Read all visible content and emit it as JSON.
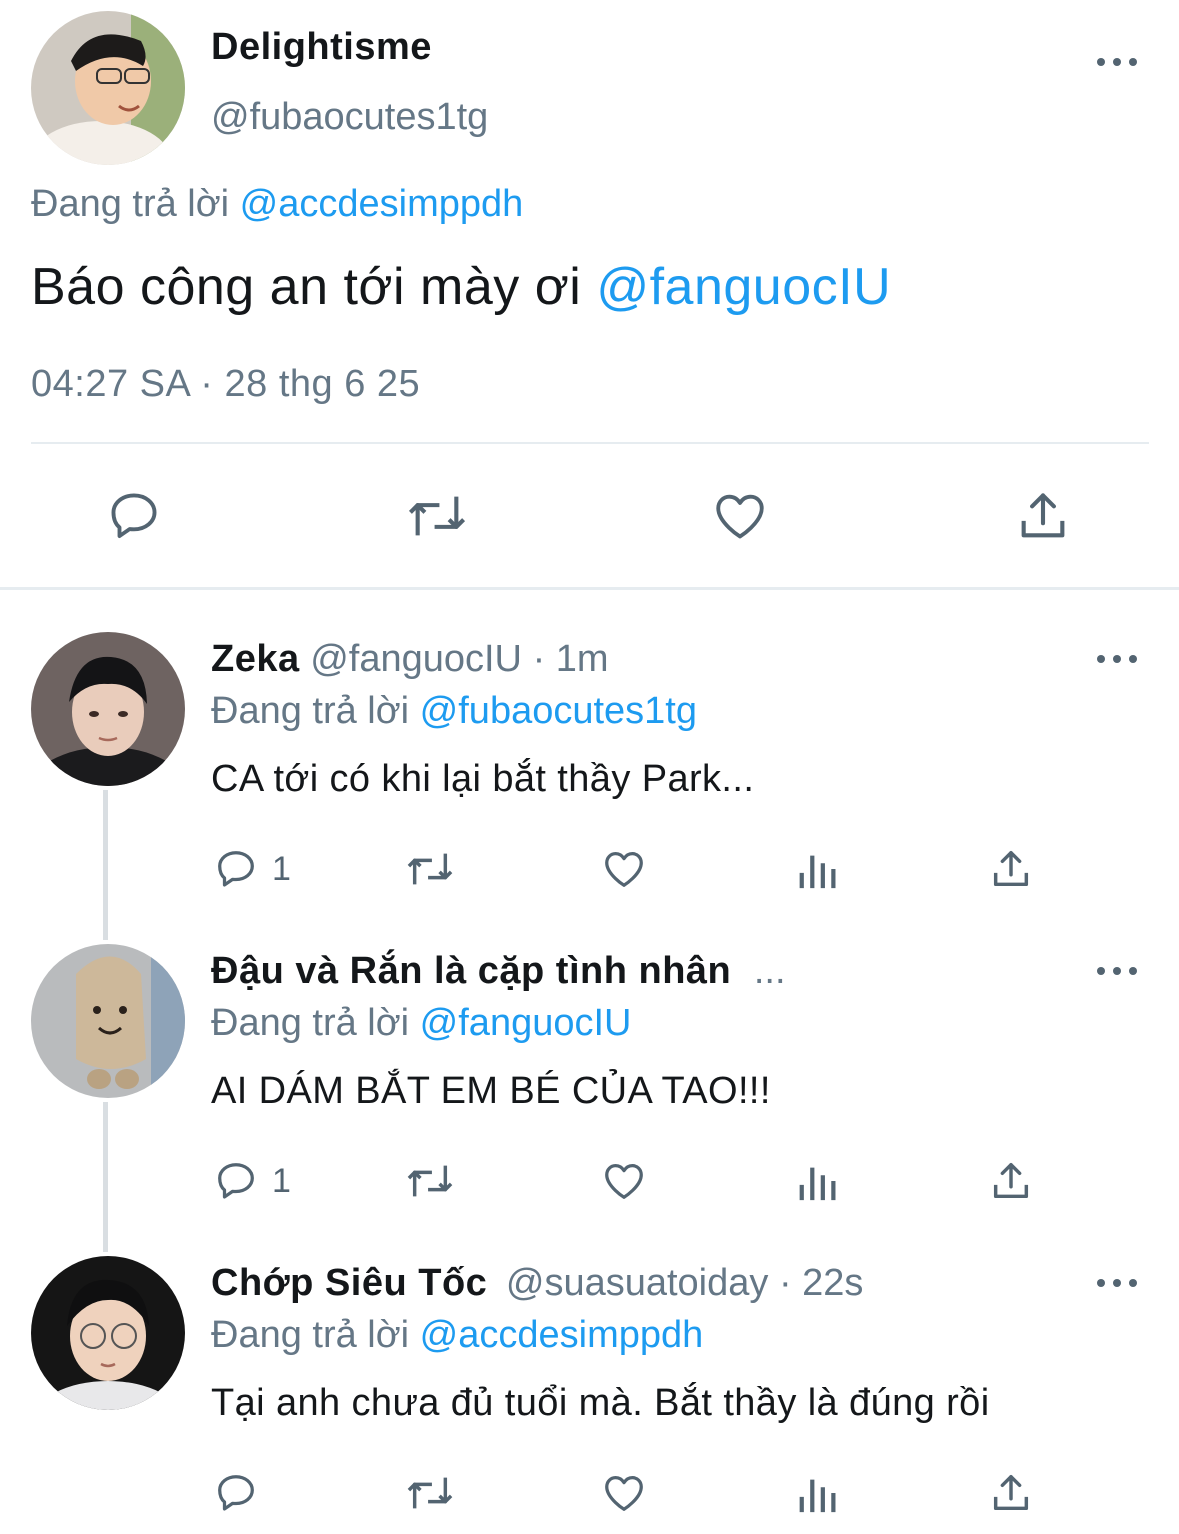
{
  "main_tweet": {
    "display_name": "Delightisme",
    "handle": "@fubaocutes1tg",
    "reply_prefix": "Đang trả lời",
    "reply_to": "@accdesimppdh",
    "text": "Báo công an tới mày ơi",
    "mention": "@fanguocIU",
    "timestamp": "04:27 SA · 28 thg 6 25"
  },
  "replies": [
    {
      "display_name": "Zeka",
      "handle": "@fanguocIU",
      "time": "· 1m",
      "reply_prefix": "Đang trả lời",
      "reply_to": "@fubaocutes1tg",
      "text": "CA tới có khi lại bắt thầy Park...",
      "reply_count": "1"
    },
    {
      "display_name": "Đậu và Rắn là cặp tình nhân",
      "handle": "...",
      "time": "",
      "reply_prefix": "Đang trả lời",
      "reply_to": "@fanguocIU",
      "text": "AI DÁM BẮT EM BÉ CỦA TAO!!!",
      "reply_count": "1"
    },
    {
      "display_name": "Chớp Siêu Tốc",
      "handle": "@suasuatoiday",
      "time": "· 22s",
      "reply_prefix": "Đang trả lời",
      "reply_to": "@accdesimppdh",
      "text": "Tại anh chưa đủ tuổi mà. Bắt thầy là đúng rồi",
      "reply_count": ""
    }
  ],
  "colors": {
    "link": "#1d9bf0",
    "secondary_text": "#657786",
    "icon": "#536471",
    "divider": "#e6ecf0"
  },
  "icons": [
    "more-icon",
    "reply-icon",
    "retweet-icon",
    "like-icon",
    "share-icon",
    "views-icon"
  ]
}
